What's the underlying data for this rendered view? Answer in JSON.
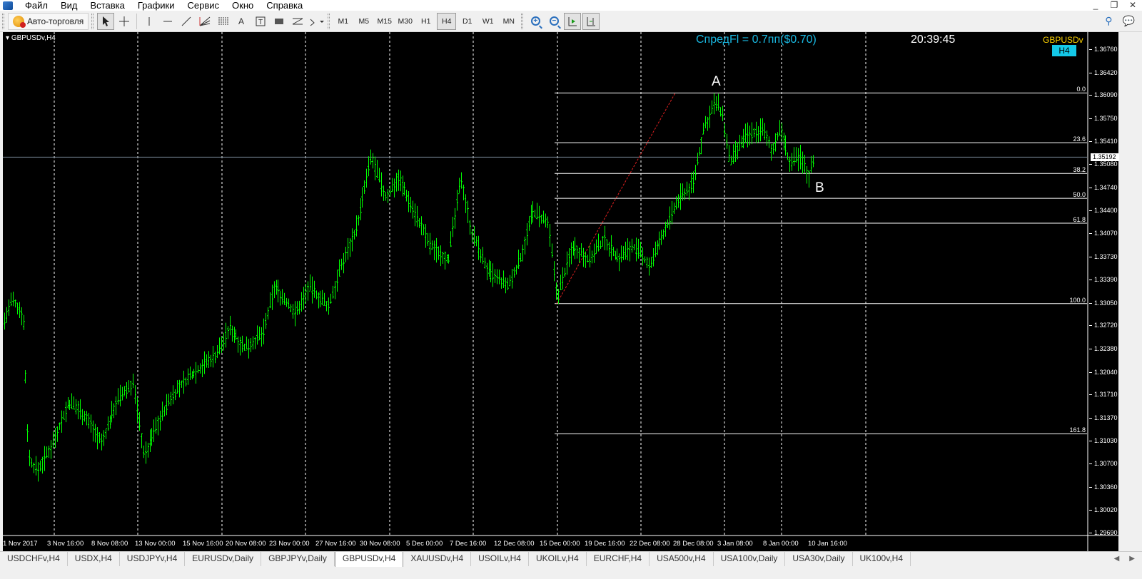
{
  "menu": [
    "Файл",
    "Вид",
    "Вставка",
    "Графики",
    "Сервис",
    "Окно",
    "Справка"
  ],
  "window_controls": [
    "_",
    "❐",
    "✕"
  ],
  "toolbar": {
    "autotrade_label": "Авто-торговля",
    "timeframes": [
      "M1",
      "M5",
      "M15",
      "M30",
      "H1",
      "H4",
      "D1",
      "W1",
      "MN"
    ],
    "active_timeframe": "H4"
  },
  "chart": {
    "symbol_label": "GBPUSDv,H4",
    "spread_text": "СпредFl = 0.7пп($0.70)",
    "clock": "20:39:45",
    "symbol_badge": "GBPUSDv",
    "timeframe_badge": "H4",
    "wave_labels": [
      "A",
      "B"
    ],
    "current_price": "1.35192",
    "price_axis": [
      "1.36760",
      "1.36420",
      "1.36090",
      "1.35750",
      "1.35410",
      "1.35080",
      "1.34740",
      "1.34400",
      "1.34070",
      "1.33730",
      "1.33390",
      "1.33050",
      "1.32720",
      "1.32380",
      "1.32040",
      "1.31710",
      "1.31370",
      "1.31030",
      "1.30700",
      "1.30360",
      "1.30020",
      "1.29690"
    ],
    "time_axis": [
      "1 Nov 2017",
      "3 Nov 16:00",
      "8 Nov 08:00",
      "13 Nov 00:00",
      "15 Nov 16:00",
      "20 Nov 08:00",
      "23 Nov 00:00",
      "27 Nov 16:00",
      "30 Nov 08:00",
      "5 Dec 00:00",
      "7 Dec 16:00",
      "12 Dec 08:00",
      "15 Dec 00:00",
      "19 Dec 16:00",
      "22 Dec 08:00",
      "28 Dec 08:00",
      "3 Jan 08:00",
      "8 Jan 00:00",
      "10 Jan 16:00"
    ],
    "fibonacci": {
      "levels": [
        "0.0",
        "23.6",
        "38.2",
        "50.0",
        "61.8",
        "100.0",
        "161.8"
      ],
      "price_high": 1.3613,
      "price_low": 1.3305
    },
    "colors": {
      "background": "#000000",
      "bars": "#00ff00",
      "fib_lines": "#ffffff",
      "trend_line": "#e02020",
      "spread_text": "#19b7e0",
      "symbol_badge": "#ffd400",
      "timeframe_badge_bg": "#14c8e8"
    }
  },
  "tabs": [
    "USDCHFv,H4",
    "USDX,H4",
    "USDJPYv,H4",
    "EURUSDv,Daily",
    "GBPJPYv,Daily",
    "GBPUSDv,H4",
    "XAUUSDv,H4",
    "USOILv,H4",
    "UKOILv,H4",
    "EURCHF,H4",
    "USA500v,H4",
    "USA100v,Daily",
    "USA30v,Daily",
    "UK100v,H4"
  ],
  "active_tab": "GBPUSDv,H4",
  "tab_arrows": [
    "◀",
    "▶"
  ]
}
